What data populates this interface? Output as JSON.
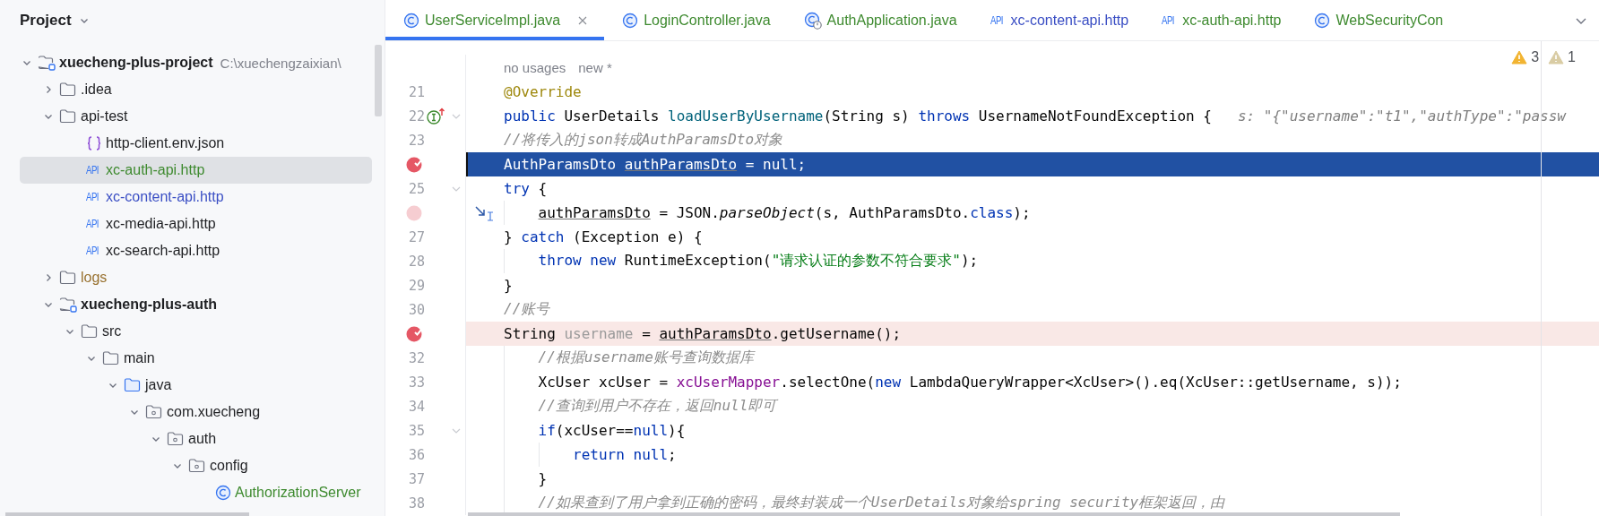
{
  "sidebar": {
    "title": "Project",
    "tree": [
      {
        "label": "xuecheng-plus-project",
        "path": "C:\\xuechengzaixian\\",
        "kind": "module",
        "color": "#1e1f22",
        "selected": false,
        "expanded": true,
        "children": [
          {
            "label": ".idea",
            "kind": "folder",
            "color": "#1e1f22",
            "selected": false,
            "expanded": false
          },
          {
            "label": "api-test",
            "kind": "folder",
            "color": "#1e1f22",
            "selected": false,
            "expanded": true,
            "children": [
              {
                "label": "http-client.env.json",
                "kind": "json",
                "color": "#1e1f22",
                "selected": false
              },
              {
                "label": "xc-auth-api.http",
                "kind": "http",
                "badge": "API",
                "color": "#3e8a2f",
                "selected": true
              },
              {
                "label": "xc-content-api.http",
                "kind": "http",
                "badge": "API",
                "color": "#3a4ec4",
                "selected": false
              },
              {
                "label": "xc-media-api.http",
                "kind": "http",
                "badge": "API",
                "color": "#1e1f22",
                "selected": false
              },
              {
                "label": "xc-search-api.http",
                "kind": "http",
                "badge": "API",
                "color": "#1e1f22",
                "selected": false
              }
            ]
          },
          {
            "label": "logs",
            "kind": "folder",
            "color": "#98712f",
            "selected": false,
            "expanded": false
          },
          {
            "label": "xuecheng-plus-auth",
            "kind": "module",
            "color": "#1e1f22",
            "selected": false,
            "expanded": true,
            "children": [
              {
                "label": "src",
                "kind": "folder",
                "color": "#1e1f22",
                "selected": false,
                "expanded": true,
                "children": [
                  {
                    "label": "main",
                    "kind": "folder",
                    "color": "#1e1f22",
                    "selected": false,
                    "expanded": true,
                    "children": [
                      {
                        "label": "java",
                        "kind": "source-folder",
                        "color": "#1e1f22",
                        "selected": false,
                        "expanded": true,
                        "children": [
                          {
                            "label": "com.xuecheng",
                            "kind": "package",
                            "color": "#1e1f22",
                            "selected": false,
                            "expanded": true,
                            "children": [
                              {
                                "label": "auth",
                                "kind": "package",
                                "color": "#1e1f22",
                                "selected": false,
                                "expanded": true,
                                "children": [
                                  {
                                    "label": "config",
                                    "kind": "package",
                                    "color": "#1e1f22",
                                    "selected": false,
                                    "expanded": true,
                                    "children": [
                                      {
                                        "label": "AuthorizationServer",
                                        "kind": "class",
                                        "color": "#3e8a2f",
                                        "selected": false
                                      }
                                    ]
                                  }
                                ]
                              }
                            ]
                          }
                        ]
                      }
                    ]
                  }
                ]
              }
            ]
          }
        ]
      }
    ]
  },
  "tabs": [
    {
      "label": "UserServiceImpl.java",
      "kind": "class",
      "color": "#3e8a2f",
      "selected": true
    },
    {
      "label": "LoginController.java",
      "kind": "class",
      "color": "#3e8a2f",
      "selected": false
    },
    {
      "label": "AuthApplication.java",
      "kind": "app-class",
      "color": "#3e8a2f",
      "selected": false
    },
    {
      "label": "xc-content-api.http",
      "kind": "http",
      "badge": "API",
      "color": "#3a4ec4",
      "selected": false
    },
    {
      "label": "xc-auth-api.http",
      "kind": "http",
      "badge": "API",
      "color": "#3e8a2f",
      "selected": false
    },
    {
      "label": "WebSecurityCon",
      "kind": "class",
      "color": "#3e8a2f",
      "selected": false
    }
  ],
  "problems": [
    {
      "kind": "warning",
      "count": "3"
    },
    {
      "kind": "weak-warning",
      "count": "1"
    }
  ],
  "lines": [
    {
      "kind": "inlay",
      "texts": [
        "no usages",
        "new *"
      ]
    },
    {
      "kind": "code",
      "number": "21",
      "tokens": [
        {
          "kind": "annotation",
          "text": "@Override"
        }
      ]
    },
    {
      "kind": "code",
      "number": "22",
      "markers": [
        {
          "kind": "implements"
        },
        {
          "kind": "fold"
        }
      ],
      "tokens": [
        {
          "kind": "keyword",
          "text": "public"
        },
        {
          "kind": "plain",
          "text": " UserDetails "
        },
        {
          "kind": "method",
          "text": "loadUserByUsername"
        },
        {
          "kind": "plain",
          "text": "(String s) "
        },
        {
          "kind": "keyword",
          "text": "throws"
        },
        {
          "kind": "plain",
          "text": " UsernameNotFoundException {"
        }
      ],
      "hint": "s: \"{\"username\":\"t1\",\"authType\":\"passw"
    },
    {
      "kind": "code",
      "number": "23",
      "tokens": [
        {
          "kind": "comment",
          "text": "//将传入的json转成AuthParamsDto对象"
        }
      ]
    },
    {
      "kind": "current-line",
      "markers": [
        {
          "kind": "breakpoint"
        }
      ],
      "tokens": [
        {
          "kind": "plain",
          "text": "AuthParamsDto "
        },
        {
          "kind": "ref",
          "text": "authParamsDto"
        },
        {
          "kind": "plain",
          "text": " = null;"
        }
      ]
    },
    {
      "kind": "code",
      "number": "25",
      "markers": [
        {
          "kind": "fold"
        }
      ],
      "tokens": [
        {
          "kind": "keyword",
          "text": "try"
        },
        {
          "kind": "plain",
          "text": " {"
        }
      ]
    },
    {
      "kind": "code",
      "markers": [
        {
          "kind": "breakpoint-muted"
        },
        {
          "kind": "step"
        }
      ],
      "tokens": [
        {
          "kind": "ref",
          "text": "    authParamsDto"
        },
        {
          "kind": "plain",
          "text": " = JSON."
        },
        {
          "kind": "italic",
          "text": "parseObject"
        },
        {
          "kind": "plain",
          "text": "(s, AuthParamsDto."
        },
        {
          "kind": "keyword",
          "text": "class"
        },
        {
          "kind": "plain",
          "text": ");"
        }
      ]
    },
    {
      "kind": "code",
      "number": "27",
      "tokens": [
        {
          "kind": "plain",
          "text": "} "
        },
        {
          "kind": "keyword",
          "text": "catch"
        },
        {
          "kind": "plain",
          "text": " (Exception e) {"
        }
      ]
    },
    {
      "kind": "code",
      "number": "28",
      "tokens": [
        {
          "kind": "keyword",
          "text": "    throw new"
        },
        {
          "kind": "plain",
          "text": " RuntimeException("
        },
        {
          "kind": "string",
          "text": "\"请求认证的参数不符合要求\""
        },
        {
          "kind": "plain",
          "text": ");"
        }
      ]
    },
    {
      "kind": "code",
      "number": "29",
      "tokens": [
        {
          "kind": "plain",
          "text": "}"
        }
      ]
    },
    {
      "kind": "code",
      "number": "30",
      "tokens": [
        {
          "kind": "comment",
          "text": "//账号"
        }
      ]
    },
    {
      "kind": "breakpoint-line",
      "markers": [
        {
          "kind": "breakpoint"
        }
      ],
      "tokens": [
        {
          "kind": "plain",
          "text": "String "
        },
        {
          "kind": "unused",
          "text": "username"
        },
        {
          "kind": "plain",
          "text": " = "
        },
        {
          "kind": "ref",
          "text": "authParamsDto"
        },
        {
          "kind": "plain",
          "text": ".getUsername();"
        }
      ]
    },
    {
      "kind": "code",
      "number": "32",
      "tokens": [
        {
          "kind": "comment",
          "text": "    //根据username账号查询数据库"
        }
      ]
    },
    {
      "kind": "code",
      "number": "33",
      "tokens": [
        {
          "kind": "plain",
          "text": "    XcUser xcUser = "
        },
        {
          "kind": "field",
          "text": "xcUserMapper"
        },
        {
          "kind": "plain",
          "text": ".selectOne("
        },
        {
          "kind": "keyword",
          "text": "new"
        },
        {
          "kind": "plain",
          "text": " LambdaQueryWrapper<XcUser>().eq(XcUser::getUsername, s));"
        }
      ]
    },
    {
      "kind": "code",
      "number": "34",
      "tokens": [
        {
          "kind": "comment",
          "text": "    //查询到用户不存在，返回null即可"
        }
      ]
    },
    {
      "kind": "code",
      "number": "35",
      "markers": [
        {
          "kind": "fold"
        }
      ],
      "tokens": [
        {
          "kind": "keyword",
          "text": "    if"
        },
        {
          "kind": "plain",
          "text": "(xcUser=="
        },
        {
          "kind": "keyword",
          "text": "null"
        },
        {
          "kind": "plain",
          "text": "){"
        }
      ]
    },
    {
      "kind": "code",
      "number": "36",
      "tokens": [
        {
          "kind": "keyword",
          "text": "        return null"
        },
        {
          "kind": "plain",
          "text": ";"
        }
      ]
    },
    {
      "kind": "code",
      "number": "37",
      "tokens": [
        {
          "kind": "plain",
          "text": "    }"
        }
      ]
    },
    {
      "kind": "code",
      "number": "38",
      "tokens": [
        {
          "kind": "comment",
          "text": "    //如果查到了用户拿到正确的密码，最终封装成一个UserDetails对象给spring security框架返回，由"
        }
      ]
    }
  ]
}
